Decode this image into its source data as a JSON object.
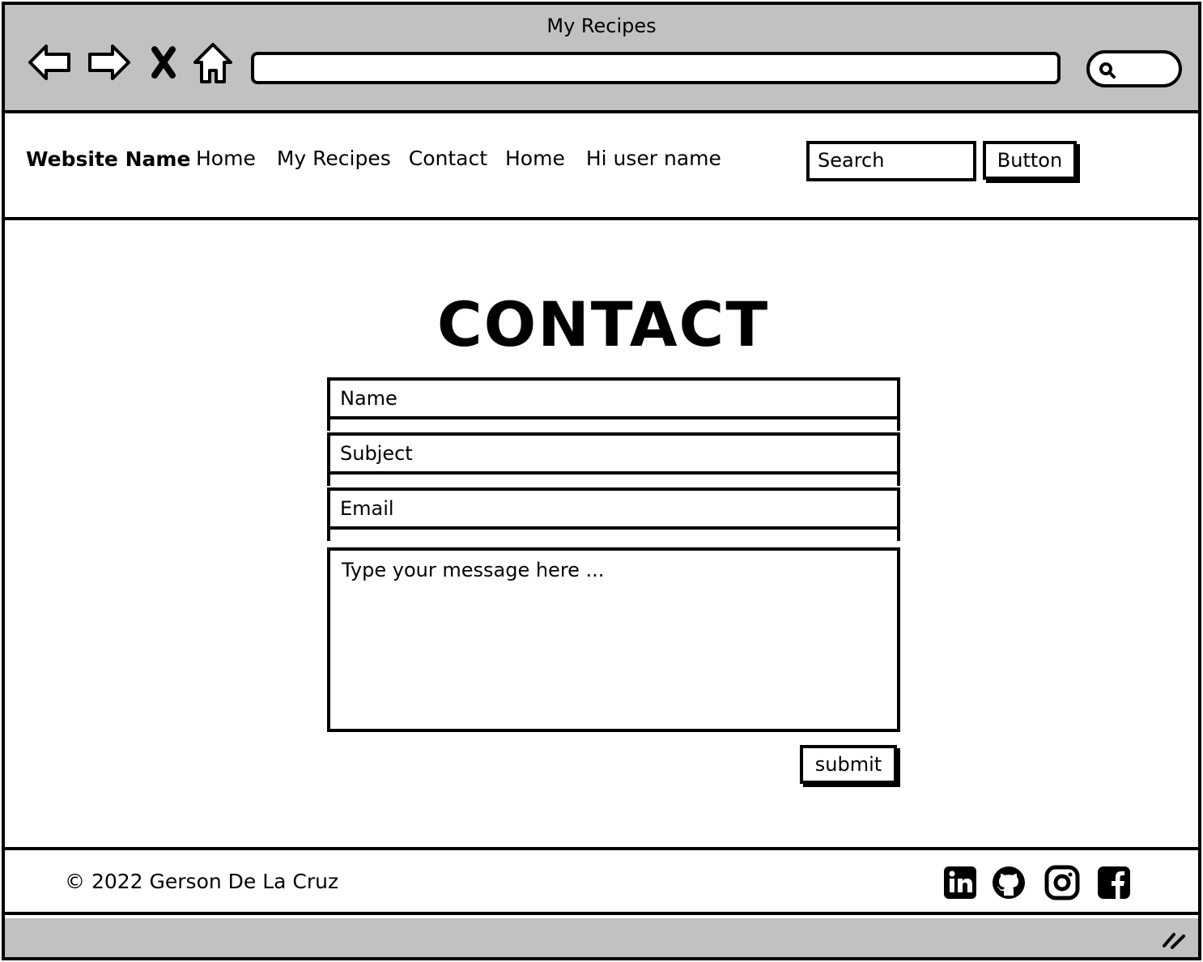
{
  "window": {
    "title": "My Recipes"
  },
  "header": {
    "brand": "Website Name",
    "nav": [
      "Home",
      "My Recipes",
      "Contact",
      "Home",
      "Hi user name"
    ],
    "search_placeholder": "Search",
    "button_label": "Button"
  },
  "main": {
    "title": "CONTACT",
    "fields": {
      "name": "Name",
      "subject": "Subject",
      "email": "Email",
      "message": "Type your message here ..."
    },
    "submit_label": "submit"
  },
  "footer": {
    "copyright": "© 2022 Gerson De La Cruz",
    "social_icons": [
      "linkedin-icon",
      "github-icon",
      "instagram-icon",
      "facebook-icon"
    ]
  },
  "colors": {
    "chrome": "#c1c1c1",
    "ink": "#000000",
    "page": "#ffffff"
  }
}
